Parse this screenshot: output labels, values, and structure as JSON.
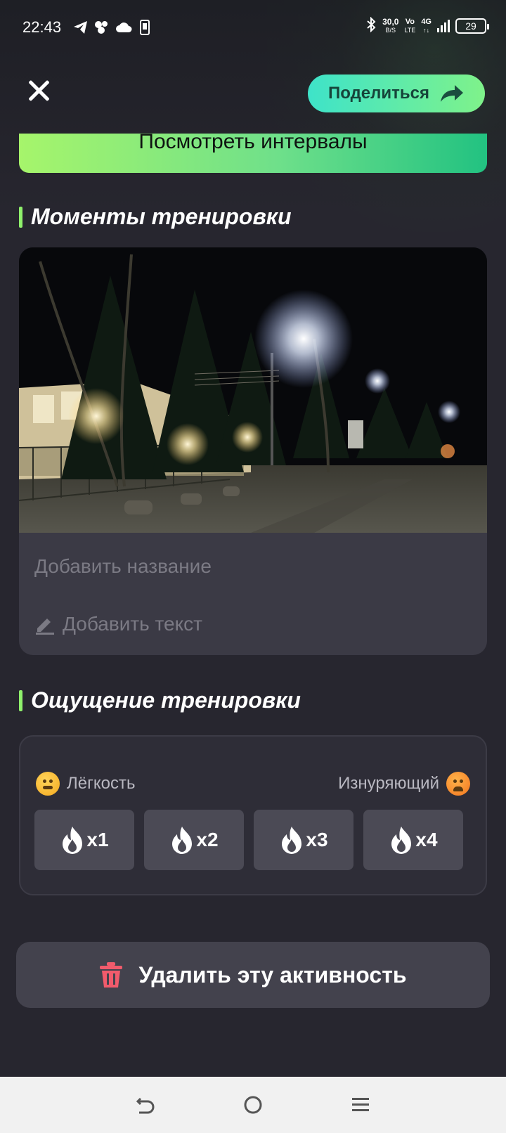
{
  "status": {
    "time": "22:43",
    "net_speed": "30,0",
    "net_unit": "B/S",
    "volte": "Vo",
    "volte_sub": "LTE",
    "network": "4G",
    "battery": "29"
  },
  "header": {
    "share_label": "Поделиться"
  },
  "intervals_label": "Посмотреть интервалы",
  "moments": {
    "title": "Моменты тренировки",
    "photo_icon": "night-street-photo",
    "add_name_placeholder": "Добавить название",
    "add_text_placeholder": "Добавить текст"
  },
  "feeling": {
    "title": "Ощущение тренировки",
    "easy_label": "Лёгкость",
    "hard_label": "Изнуряющий",
    "levels": [
      "x1",
      "x2",
      "x3",
      "x4"
    ]
  },
  "delete_label": "Удалить эту активность",
  "colors": {
    "accent_green": "#8ff06c",
    "share_gradient_start": "#3ee3c9",
    "delete_icon": "#f15b6c"
  }
}
